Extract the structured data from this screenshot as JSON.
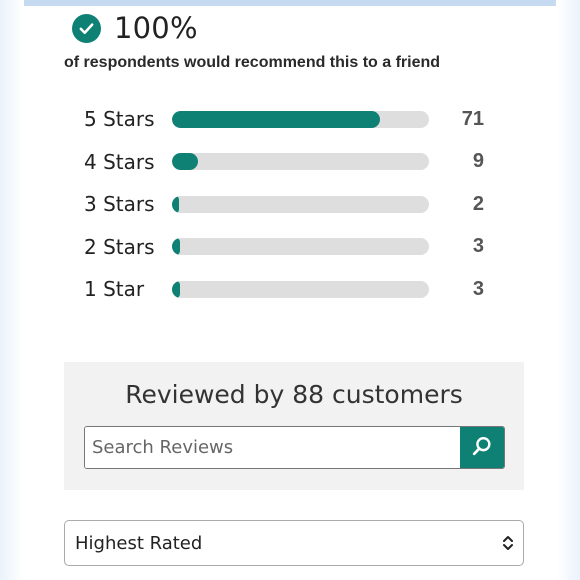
{
  "recommend": {
    "percent": "100%",
    "text": "of respondents would recommend this to a friend"
  },
  "distribution": [
    {
      "label": "5 Stars",
      "count": "71",
      "fraction": 0.81
    },
    {
      "label": "4 Stars",
      "count": "9",
      "fraction": 0.1
    },
    {
      "label": "3 Stars",
      "count": "2",
      "fraction": 0.02
    },
    {
      "label": "2 Stars",
      "count": "3",
      "fraction": 0.03
    },
    {
      "label": "1 Star",
      "count": "3",
      "fraction": 0.03
    }
  ],
  "reviews": {
    "title": "Reviewed by 88 customers",
    "search_placeholder": "Search Reviews"
  },
  "sort": {
    "selected": "Highest Rated"
  },
  "colors": {
    "accent": "#0e8174",
    "track": "#dedede",
    "panel": "#f2f2f2"
  },
  "icons": {
    "check": "check-circle-icon",
    "search": "search-icon",
    "sort": "chevron-up-down-icon"
  }
}
